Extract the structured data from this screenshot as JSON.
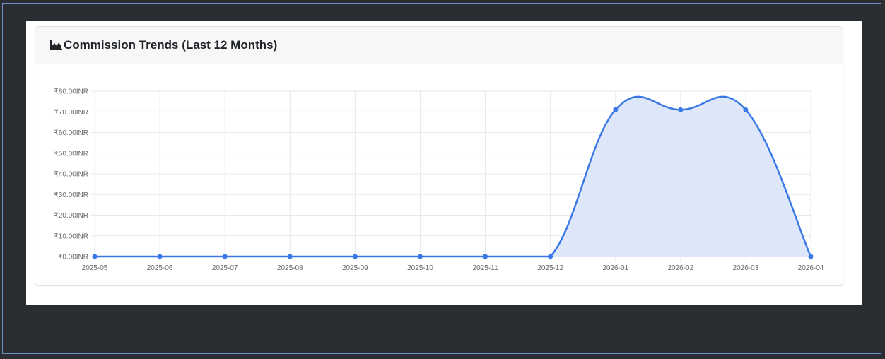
{
  "card": {
    "title": "Commission Trends (Last 12 Months)",
    "icon": "area-chart-icon"
  },
  "colors": {
    "line": "#3b78e7",
    "fill": "#dce6fa",
    "grid": "#e9e9e9",
    "background": "#2a2d32"
  },
  "chart_data": {
    "type": "area",
    "title": "Commission Trends (Last 12 Months)",
    "x": [
      "2025-05",
      "2025-06",
      "2025-07",
      "2025-08",
      "2025-09",
      "2025-10",
      "2025-11",
      "2025-12",
      "2026-01",
      "2026-02",
      "2026-03",
      "2026-04"
    ],
    "series": [
      {
        "values": [
          0,
          0,
          0,
          0,
          0,
          0,
          0,
          0,
          71,
          71,
          71,
          0
        ]
      }
    ],
    "yticks": [
      "₹0.00INR",
      "₹10.00INR",
      "₹20.00INR",
      "₹30.00INR",
      "₹40.00INR",
      "₹50.00INR",
      "₹60.00INR",
      "₹70.00INR",
      "₹80.00INR"
    ],
    "ylim": [
      0,
      80
    ],
    "grid": true,
    "legend": "none"
  }
}
